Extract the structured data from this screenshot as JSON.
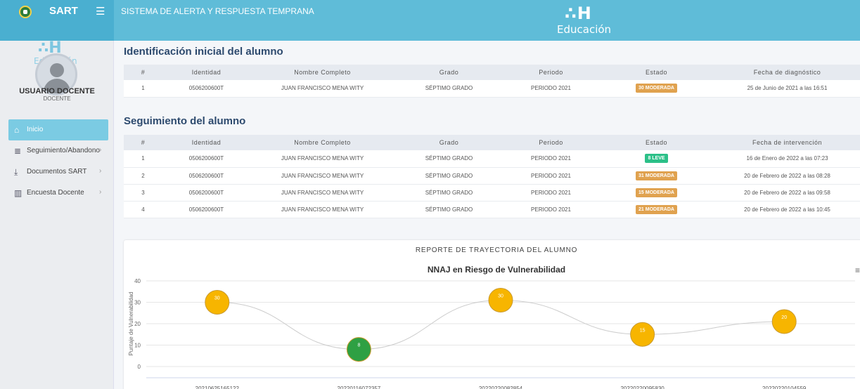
{
  "header": {
    "brand_name": "SART",
    "menu_icon": "menu-icon",
    "system_title": "SISTEMA DE ALERTA Y RESPUESTA TEMPRANA",
    "logo_mark": "∴H",
    "logo_text": "Educación"
  },
  "sidebar": {
    "logo_mark": "∴H",
    "logo_text": "Educación",
    "user_name": "USUARIO DOCENTE",
    "user_role": "DOCENTE",
    "items": [
      {
        "label": "Inicio",
        "icon": "home-icon",
        "active": true
      },
      {
        "label": "Seguimiento/Abandono",
        "icon": "database-icon",
        "active": false
      },
      {
        "label": "Documentos SART",
        "icon": "download-icon",
        "active": false
      },
      {
        "label": "Encuesta Docente",
        "icon": "bar-chart-icon",
        "active": false
      }
    ]
  },
  "initial": {
    "title": "Identificación inicial del alumno",
    "columns": [
      "#",
      "Identidad",
      "Nombre Completo",
      "Grado",
      "Periodo",
      "Estado",
      "Fecha de diagnóstico"
    ],
    "rows": [
      {
        "num": "1",
        "id": "0506200600T",
        "name": "JUAN FRANCISCO MENA WITY",
        "grade": "SÉPTIMO GRADO",
        "period": "PERIODO 2021",
        "status": "30 MODERADA",
        "status_color": "#e0a24f",
        "date": "25 de Junio de 2021 a las 16:51"
      }
    ]
  },
  "followup": {
    "title": "Seguimiento del alumno",
    "columns": [
      "#",
      "Identidad",
      "Nombre Completo",
      "Grado",
      "Periodo",
      "Estado",
      "Fecha de intervención"
    ],
    "rows": [
      {
        "num": "1",
        "id": "0506200600T",
        "name": "JUAN FRANCISCO MENA WITY",
        "grade": "SÉPTIMO GRADO",
        "period": "PERIODO 2021",
        "status": "8 LEVE",
        "status_color": "#2cc088",
        "date": "16 de Enero de 2022 a las 07:23"
      },
      {
        "num": "2",
        "id": "0506200600T",
        "name": "JUAN FRANCISCO MENA WITY",
        "grade": "SÉPTIMO GRADO",
        "period": "PERIODO 2021",
        "status": "31 MODERADA",
        "status_color": "#e0a24f",
        "date": "20 de Febrero de 2022 a las 08:28"
      },
      {
        "num": "3",
        "id": "0506200600T",
        "name": "JUAN FRANCISCO MENA WITY",
        "grade": "SÉPTIMO GRADO",
        "period": "PERIODO 2021",
        "status": "15 MODERADA",
        "status_color": "#e0a24f",
        "date": "20 de Febrero de 2022 a las 09:58"
      },
      {
        "num": "4",
        "id": "0506200600T",
        "name": "JUAN FRANCISCO MENA WITY",
        "grade": "SÉPTIMO GRADO",
        "period": "PERIODO 2021",
        "status": "21 MODERADA",
        "status_color": "#e0a24f",
        "date": "20 de Febrero de 2022 a las 10:45"
      }
    ]
  },
  "report": {
    "title": "REPORTE DE TRAYECTORIA DEL ALUMNO",
    "menu_icon": "hamburger-menu-icon"
  },
  "chart_data": {
    "type": "line",
    "title": "NNAJ en Riesgo de Vulnerabilidad",
    "ylabel": "Puntaje de Vulnerabilidad",
    "xlabel": "",
    "ylim": [
      0,
      40
    ],
    "yticks": [
      0,
      10,
      20,
      30,
      40
    ],
    "categories": [
      "20210625165122",
      "20220116072357",
      "20220220082854",
      "20220220095830",
      "20220220104559"
    ],
    "values": [
      30,
      8,
      31,
      15,
      21
    ],
    "point_labels": [
      "30",
      "8",
      "30",
      "15",
      "20"
    ],
    "point_colors": [
      "#f7b500",
      "#2ea043",
      "#f7b500",
      "#f7b500",
      "#f7b500"
    ],
    "line_color": "#cccccc",
    "grid": true,
    "legend": "none"
  }
}
